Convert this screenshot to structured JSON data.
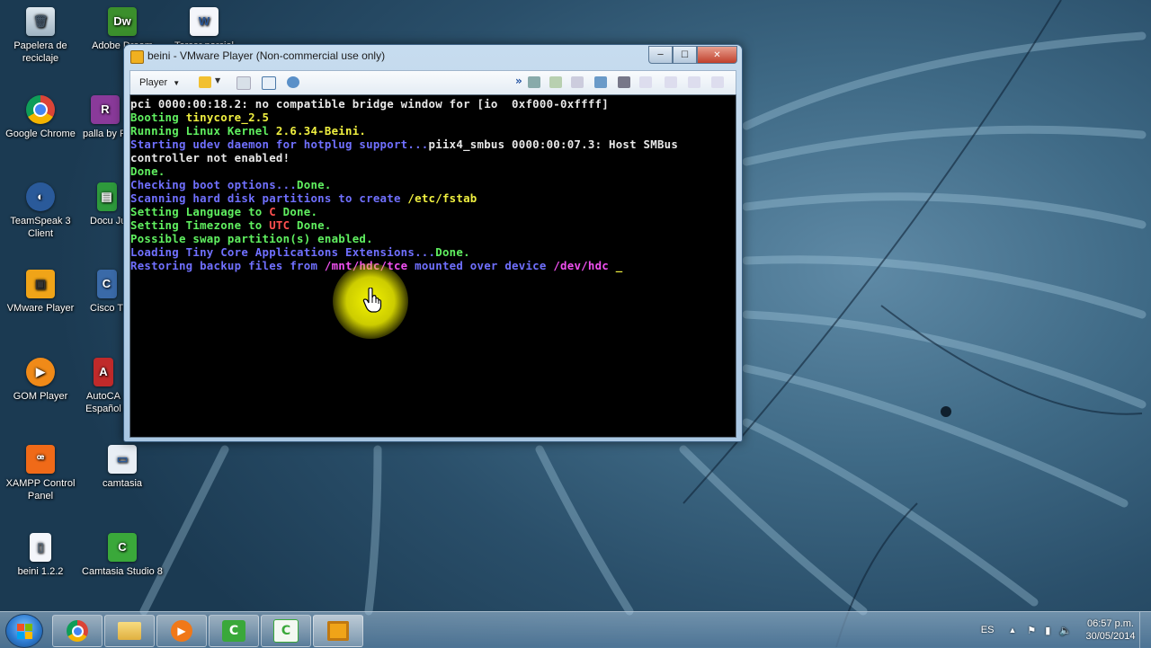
{
  "window": {
    "title": "beini - VMware Player (Non-commercial use only)",
    "menu_label": "Player",
    "min_symbol": "─",
    "max_symbol": "☐",
    "close_symbol": "✕"
  },
  "console": {
    "lines": [
      [
        {
          "t": "pci 0000:00:18.2: no compatible bridge window for [io  0xf000-0xffff]",
          "c": "w"
        }
      ],
      [
        {
          "t": "Booting ",
          "c": "g"
        },
        {
          "t": "tinycore_2.5",
          "c": "y"
        }
      ],
      [
        {
          "t": "Running Linux Kernel ",
          "c": "g"
        },
        {
          "t": "2.6.34-Beini.",
          "c": "y"
        }
      ],
      [
        {
          "t": "Starting udev daemon for hotplug support...",
          "c": "b"
        },
        {
          "t": "piix4_smbus 0000:00:07.3: Host SMBus",
          "c": "w"
        }
      ],
      [
        {
          "t": "controller not enabled!",
          "c": "w"
        }
      ],
      [
        {
          "t": "Done.",
          "c": "g"
        }
      ],
      [
        {
          "t": "Checking boot options...",
          "c": "b"
        },
        {
          "t": "Done.",
          "c": "g"
        }
      ],
      [
        {
          "t": "Scanning hard disk partitions to create ",
          "c": "b"
        },
        {
          "t": "/etc/fstab",
          "c": "y"
        }
      ],
      [
        {
          "t": "Setting Language to ",
          "c": "g"
        },
        {
          "t": "C",
          "c": "r"
        },
        {
          "t": " Done.",
          "c": "g"
        }
      ],
      [
        {
          "t": "Setting Timezone to ",
          "c": "g"
        },
        {
          "t": "UTC",
          "c": "r"
        },
        {
          "t": " Done.",
          "c": "g"
        }
      ],
      [
        {
          "t": "Possible swap partition(s) enabled.",
          "c": "g"
        }
      ],
      [
        {
          "t": "Loading Tiny Core Applications Extensions...",
          "c": "b"
        },
        {
          "t": "Done.",
          "c": "g"
        }
      ],
      [
        {
          "t": "Restoring backup files from ",
          "c": "b"
        },
        {
          "t": "/mnt/hdc/tce",
          "c": "m"
        },
        {
          "t": " mounted over device ",
          "c": "b"
        },
        {
          "t": "/dev/hdc",
          "c": "m"
        },
        {
          "t": " ",
          "c": "w"
        },
        {
          "t": "_",
          "c": "y"
        }
      ]
    ]
  },
  "desktop_icons": {
    "recycle": "Papelera de reciclaje",
    "dreamweaver": "Adobe Dream",
    "word": "Tercer parcial",
    "chrome": "Google Chrome",
    "winrar": "palla by Free_w",
    "teamspeak": "TeamSpeak 3 Client",
    "docs": "Docu Ju",
    "vmware": "VMware Player",
    "cisco": "Cisco Tra",
    "gom": "GOM Player",
    "autocad": "AutoCA Español",
    "xampp": "XAMPP Control Panel",
    "camtasia": "camtasia",
    "beini": "beini 1.2.2",
    "camtasia8": "Camtasia Studio 8"
  },
  "taskbar": {
    "language": "ES",
    "time": "06:57 p.m.",
    "date": "30/05/2014"
  },
  "colors": {
    "green": "#60f060",
    "yellow": "#f0f040",
    "blue": "#7070ff",
    "magenta": "#f050f0",
    "red": "#ff5050",
    "white": "#e8e8e8"
  }
}
